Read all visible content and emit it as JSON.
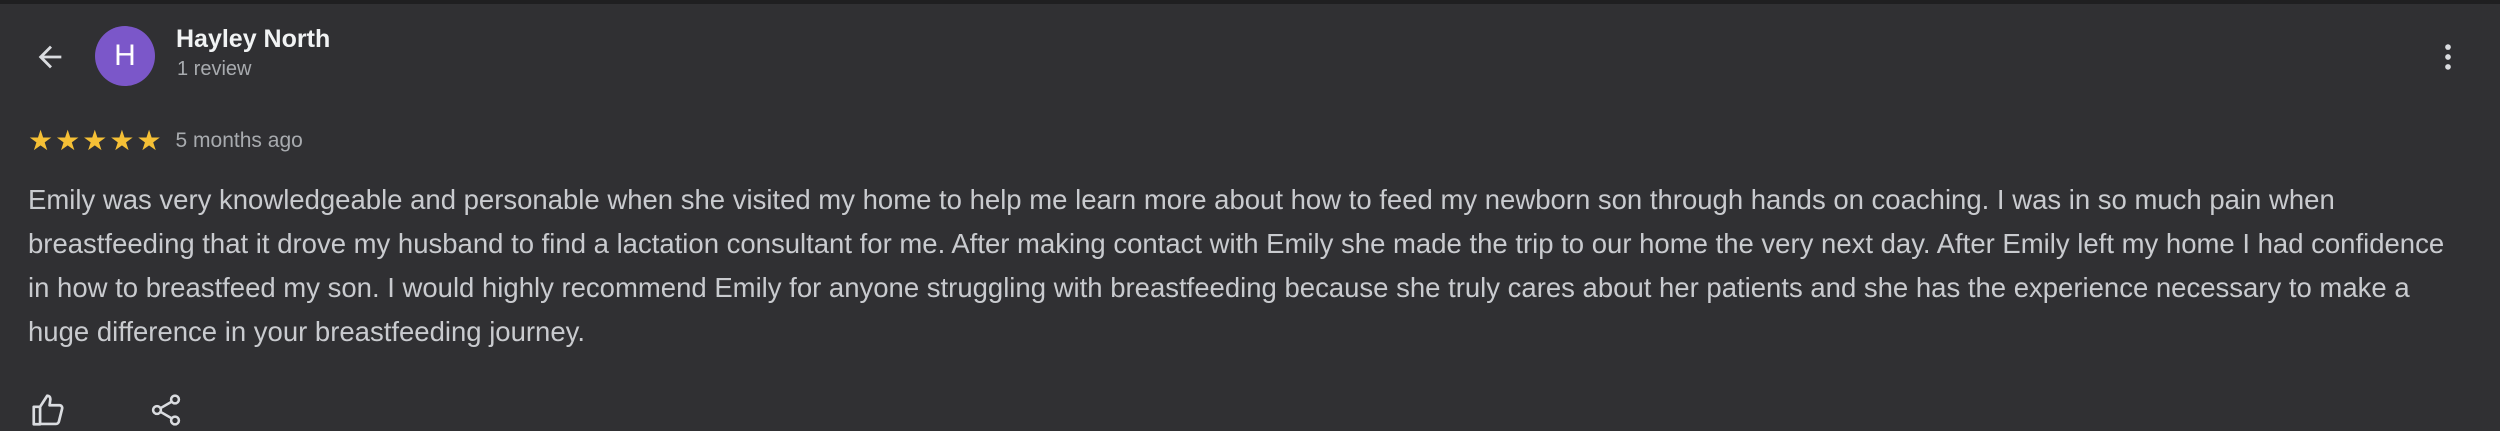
{
  "review": {
    "author": {
      "initial": "H",
      "name": "Hayley North",
      "meta": "1 review",
      "avatar_color": "#7b57c9"
    },
    "rating": {
      "stars": 5,
      "max": 5,
      "star_glyph": "★",
      "star_color": "#f5c036"
    },
    "date": "5 months ago",
    "text": "Emily was very knowledgeable and personable when she visited my home to help me learn more about how to feed my newborn son through hands on coaching. I was in so much pain when breastfeeding that it drove my husband to find a lactation consultant for me. After making contact with Emily she made the trip to our home the very next day. After Emily left my home I had confidence in how to breastfeed my son. I would highly recommend Emily for anyone struggling with breastfeeding because she truly cares about her patients and she has the experience necessary to make a huge difference in your breastfeeding journey."
  },
  "icons": {
    "back": "arrow-left-icon",
    "more": "more-vert-icon",
    "like": "thumbs-up-icon",
    "share": "share-icon"
  },
  "theme": {
    "background": "#303033",
    "text_primary": "#f1f3f4",
    "text_secondary": "#a8abaf",
    "text_body": "#c9cbcf"
  }
}
